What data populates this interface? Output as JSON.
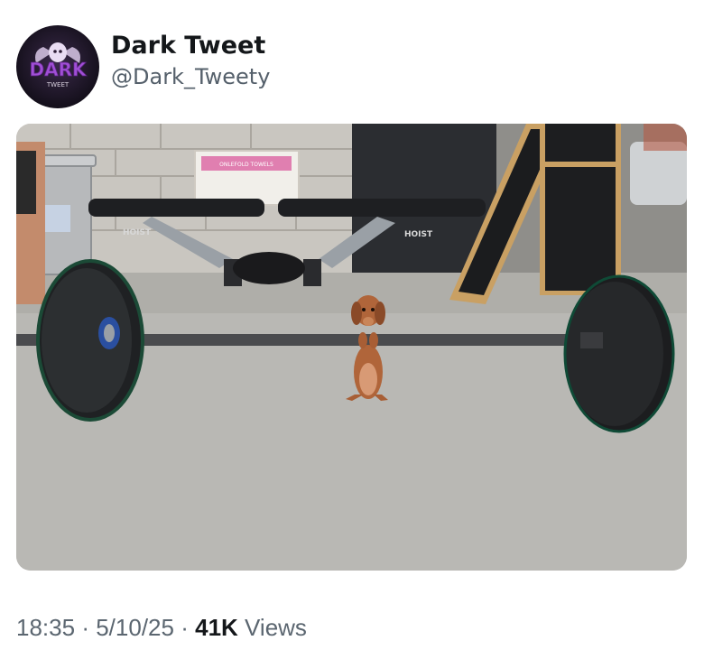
{
  "tweet": {
    "author": {
      "display_name": "Dark Tweet",
      "handle": "@Dark_Tweety",
      "avatar_text": "DARK",
      "avatar_subtext": "TWEET"
    },
    "media": {
      "box_label": "ONLEFOLD TOWELS",
      "bench_brand_left": "HOIST",
      "bench_brand_right": "HOIST"
    },
    "meta": {
      "time": "18:35",
      "separator": "·",
      "date": "5/10/25",
      "views_count": "41K",
      "views_label": "Views"
    }
  },
  "colors": {
    "name": "#14171a",
    "secondary": "#5b6670",
    "avatar_accent": "#a04fd6"
  }
}
